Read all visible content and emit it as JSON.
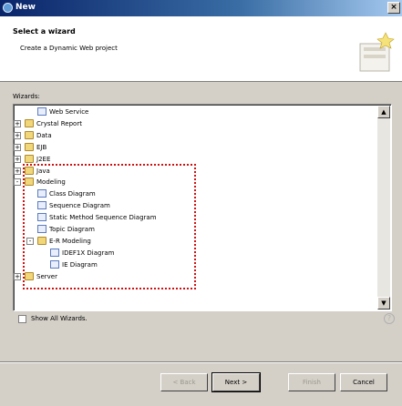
{
  "window": {
    "title": "New"
  },
  "header": {
    "title": "Select a wizard",
    "description": "Create a Dynamic Web project"
  },
  "wizards_label": "Wizards:",
  "tree": {
    "rows": [
      {
        "label": "Web Service",
        "level": 1,
        "expander": "",
        "icon": "web-service-icon"
      },
      {
        "label": "Crystal Report",
        "level": 0,
        "expander": "+",
        "icon": "folder-icon"
      },
      {
        "label": "Data",
        "level": 0,
        "expander": "+",
        "icon": "folder-icon"
      },
      {
        "label": "EJB",
        "level": 0,
        "expander": "+",
        "icon": "folder-icon"
      },
      {
        "label": "J2EE",
        "level": 0,
        "expander": "+",
        "icon": "folder-icon"
      },
      {
        "label": "Java",
        "level": 0,
        "expander": "+",
        "icon": "folder-icon"
      },
      {
        "label": "Modeling",
        "level": 0,
        "expander": "-",
        "icon": "folder-icon"
      },
      {
        "label": "Class Diagram",
        "level": 1,
        "expander": "",
        "icon": "diagram-icon"
      },
      {
        "label": "Sequence Diagram",
        "level": 1,
        "expander": "",
        "icon": "diagram-icon"
      },
      {
        "label": "Static Method Sequence Diagram",
        "level": 1,
        "expander": "",
        "icon": "diagram-icon"
      },
      {
        "label": "Topic Diagram",
        "level": 1,
        "expander": "",
        "icon": "diagram-icon"
      },
      {
        "label": "E-R Modeling",
        "level": 1,
        "expander": "-",
        "icon": "folder-icon"
      },
      {
        "label": "IDEF1X Diagram",
        "level": 2,
        "expander": "",
        "icon": "diagram-icon"
      },
      {
        "label": "IE Diagram",
        "level": 2,
        "expander": "",
        "icon": "diagram-icon"
      },
      {
        "label": "Server",
        "level": 0,
        "expander": "+",
        "icon": "folder-icon"
      }
    ]
  },
  "show_all_wizards": {
    "label": "Show All Wizards.",
    "checked": false
  },
  "buttons": {
    "back": "< Back",
    "next": "Next >",
    "finish": "Finish",
    "cancel": "Cancel"
  },
  "colors": {
    "titlebar_start": "#0a246a",
    "dialog_bg": "#d4d0c8",
    "annotation_border": "#d01010"
  }
}
